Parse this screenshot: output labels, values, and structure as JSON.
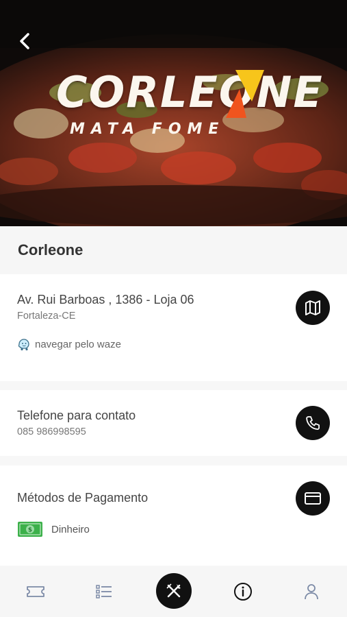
{
  "hero": {
    "logo_title": "CORLEONE",
    "logo_subtitle": "MATA FOME",
    "back_icon": "chevron-left-icon"
  },
  "restaurant": {
    "name": "Corleone"
  },
  "address": {
    "street": "Av. Rui Barboas , 1386 - Loja 06",
    "city": "Fortaleza-CE",
    "waze_label": "navegar pelo waze",
    "map_icon": "map-icon"
  },
  "contact": {
    "label": "Telefone para contato",
    "phone": "085 986998595",
    "phone_icon": "phone-icon"
  },
  "payment": {
    "label": "Métodos de Pagamento",
    "method": "Dinheiro",
    "card_icon": "credit-card-icon",
    "cash_icon": "cash-icon"
  },
  "nav": {
    "items": [
      "ticket-icon",
      "list-icon",
      "fork-knife-icon",
      "info-icon",
      "user-icon"
    ],
    "active": "info-icon"
  },
  "colors": {
    "accent_orange": "#f0541e",
    "accent_yellow": "#f7c51b",
    "black": "#111111",
    "cash_green": "#3cb04a"
  }
}
